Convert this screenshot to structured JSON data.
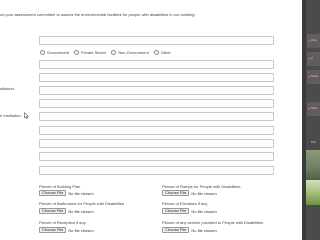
{
  "form": {
    "intro_text": "nd your assessment committee to assess the environmental facilities for people with disabilities in our building:",
    "sector_options": [
      "Government",
      "Private Sector",
      "Non-Government",
      "Other"
    ],
    "label_institution_partial": "stitution:",
    "label_institution2_partial": "e Institution:"
  },
  "uploads": [
    {
      "label": "Picture of Building Plan",
      "button": "Choose File",
      "status": "No file chosen"
    },
    {
      "label": "Picture of Ramps for People with Disabilities",
      "button": "Choose File",
      "status": "No file chosen"
    },
    {
      "label": "Picture of Bathrooms for People with Disabilities",
      "button": "Choose File",
      "status": "No file chosen"
    },
    {
      "label": "Picture of Elevators if any",
      "button": "Choose File",
      "status": "No file chosen"
    },
    {
      "label": "Picture of Reception if any",
      "button": "Choose File",
      "status": "No file chosen"
    },
    {
      "label": "Picture of any service provided to People with Disabilities",
      "button": "Choose File",
      "status": "No file chosen"
    }
  ],
  "side_panel": {
    "items": [
      "Zino",
      "Z",
      "Mello",
      "Sobl"
    ],
    "caption": "Pho"
  }
}
